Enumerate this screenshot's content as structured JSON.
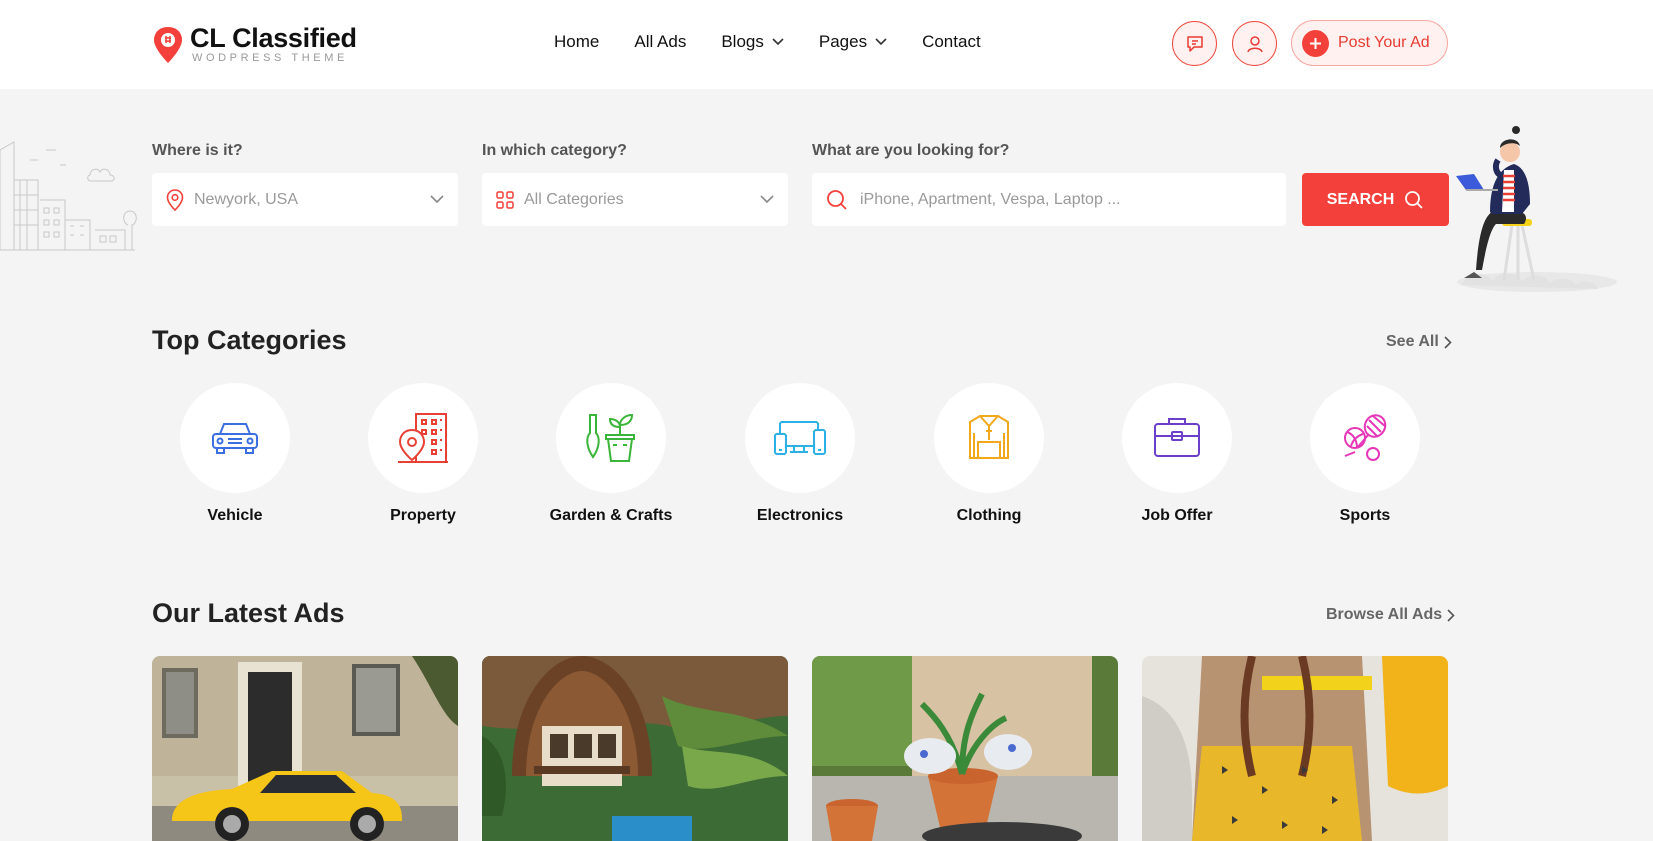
{
  "header": {
    "logo_name": "CL Classified",
    "logo_tagline": "WODPRESS THEME",
    "nav": [
      {
        "label": "Home",
        "dropdown": false
      },
      {
        "label": "All Ads",
        "dropdown": false
      },
      {
        "label": "Blogs",
        "dropdown": true
      },
      {
        "label": "Pages",
        "dropdown": true
      },
      {
        "label": "Contact",
        "dropdown": false
      }
    ],
    "chat_icon": "chat-icon",
    "user_icon": "user-icon",
    "post_ad_label": "Post Your Ad"
  },
  "search": {
    "location_label": "Where is it?",
    "location_value": "Newyork, USA",
    "category_label": "In which category?",
    "category_value": "All Categories",
    "keyword_label": "What are you looking for?",
    "keyword_placeholder": "iPhone, Apartment, Vespa, Laptop ...",
    "button_label": "SEARCH"
  },
  "categories": {
    "title": "Top Categories",
    "see_all": "See All",
    "items": [
      {
        "label": "Vehicle",
        "icon": "car-icon",
        "color": "#3b6fe0"
      },
      {
        "label": "Property",
        "icon": "building-icon",
        "color": "#e84034"
      },
      {
        "label": "Garden & Crafts",
        "icon": "plant-icon",
        "color": "#3ab53a"
      },
      {
        "label": "Electronics",
        "icon": "devices-icon",
        "color": "#2bb1e8"
      },
      {
        "label": "Clothing",
        "icon": "shirt-icon",
        "color": "#f2a81d"
      },
      {
        "label": "Job Offer",
        "icon": "briefcase-icon",
        "color": "#6b3fc9"
      },
      {
        "label": "Sports",
        "icon": "sports-icon",
        "color": "#e636b8"
      }
    ]
  },
  "latest_ads": {
    "title": "Our Latest Ads",
    "browse_all": "Browse All Ads"
  },
  "colors": {
    "accent": "#f3403a",
    "background": "#f4f4f4"
  }
}
